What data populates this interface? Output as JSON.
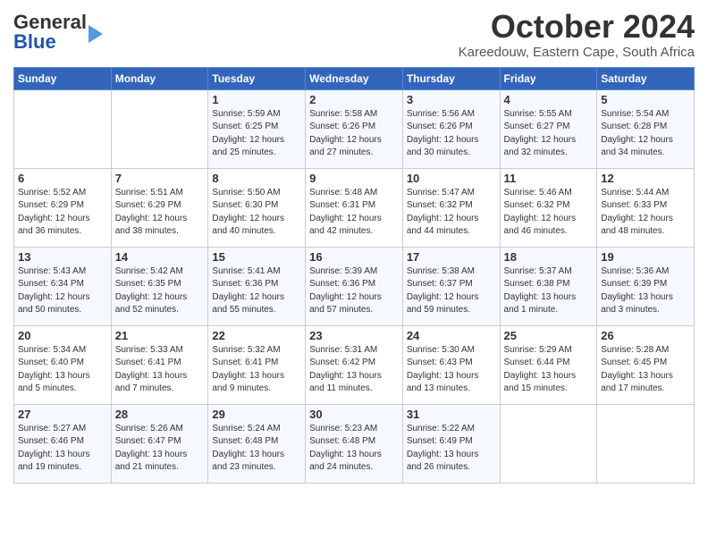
{
  "header": {
    "logo_general": "General",
    "logo_blue": "Blue",
    "month_year": "October 2024",
    "location": "Kareedouw, Eastern Cape, South Africa"
  },
  "days_of_week": [
    "Sunday",
    "Monday",
    "Tuesday",
    "Wednesday",
    "Thursday",
    "Friday",
    "Saturday"
  ],
  "weeks": [
    [
      {
        "day": "",
        "info": ""
      },
      {
        "day": "",
        "info": ""
      },
      {
        "day": "1",
        "info": "Sunrise: 5:59 AM\nSunset: 6:25 PM\nDaylight: 12 hours\nand 25 minutes."
      },
      {
        "day": "2",
        "info": "Sunrise: 5:58 AM\nSunset: 6:26 PM\nDaylight: 12 hours\nand 27 minutes."
      },
      {
        "day": "3",
        "info": "Sunrise: 5:56 AM\nSunset: 6:26 PM\nDaylight: 12 hours\nand 30 minutes."
      },
      {
        "day": "4",
        "info": "Sunrise: 5:55 AM\nSunset: 6:27 PM\nDaylight: 12 hours\nand 32 minutes."
      },
      {
        "day": "5",
        "info": "Sunrise: 5:54 AM\nSunset: 6:28 PM\nDaylight: 12 hours\nand 34 minutes."
      }
    ],
    [
      {
        "day": "6",
        "info": "Sunrise: 5:52 AM\nSunset: 6:29 PM\nDaylight: 12 hours\nand 36 minutes."
      },
      {
        "day": "7",
        "info": "Sunrise: 5:51 AM\nSunset: 6:29 PM\nDaylight: 12 hours\nand 38 minutes."
      },
      {
        "day": "8",
        "info": "Sunrise: 5:50 AM\nSunset: 6:30 PM\nDaylight: 12 hours\nand 40 minutes."
      },
      {
        "day": "9",
        "info": "Sunrise: 5:48 AM\nSunset: 6:31 PM\nDaylight: 12 hours\nand 42 minutes."
      },
      {
        "day": "10",
        "info": "Sunrise: 5:47 AM\nSunset: 6:32 PM\nDaylight: 12 hours\nand 44 minutes."
      },
      {
        "day": "11",
        "info": "Sunrise: 5:46 AM\nSunset: 6:32 PM\nDaylight: 12 hours\nand 46 minutes."
      },
      {
        "day": "12",
        "info": "Sunrise: 5:44 AM\nSunset: 6:33 PM\nDaylight: 12 hours\nand 48 minutes."
      }
    ],
    [
      {
        "day": "13",
        "info": "Sunrise: 5:43 AM\nSunset: 6:34 PM\nDaylight: 12 hours\nand 50 minutes."
      },
      {
        "day": "14",
        "info": "Sunrise: 5:42 AM\nSunset: 6:35 PM\nDaylight: 12 hours\nand 52 minutes."
      },
      {
        "day": "15",
        "info": "Sunrise: 5:41 AM\nSunset: 6:36 PM\nDaylight: 12 hours\nand 55 minutes."
      },
      {
        "day": "16",
        "info": "Sunrise: 5:39 AM\nSunset: 6:36 PM\nDaylight: 12 hours\nand 57 minutes."
      },
      {
        "day": "17",
        "info": "Sunrise: 5:38 AM\nSunset: 6:37 PM\nDaylight: 12 hours\nand 59 minutes."
      },
      {
        "day": "18",
        "info": "Sunrise: 5:37 AM\nSunset: 6:38 PM\nDaylight: 13 hours\nand 1 minute."
      },
      {
        "day": "19",
        "info": "Sunrise: 5:36 AM\nSunset: 6:39 PM\nDaylight: 13 hours\nand 3 minutes."
      }
    ],
    [
      {
        "day": "20",
        "info": "Sunrise: 5:34 AM\nSunset: 6:40 PM\nDaylight: 13 hours\nand 5 minutes."
      },
      {
        "day": "21",
        "info": "Sunrise: 5:33 AM\nSunset: 6:41 PM\nDaylight: 13 hours\nand 7 minutes."
      },
      {
        "day": "22",
        "info": "Sunrise: 5:32 AM\nSunset: 6:41 PM\nDaylight: 13 hours\nand 9 minutes."
      },
      {
        "day": "23",
        "info": "Sunrise: 5:31 AM\nSunset: 6:42 PM\nDaylight: 13 hours\nand 11 minutes."
      },
      {
        "day": "24",
        "info": "Sunrise: 5:30 AM\nSunset: 6:43 PM\nDaylight: 13 hours\nand 13 minutes."
      },
      {
        "day": "25",
        "info": "Sunrise: 5:29 AM\nSunset: 6:44 PM\nDaylight: 13 hours\nand 15 minutes."
      },
      {
        "day": "26",
        "info": "Sunrise: 5:28 AM\nSunset: 6:45 PM\nDaylight: 13 hours\nand 17 minutes."
      }
    ],
    [
      {
        "day": "27",
        "info": "Sunrise: 5:27 AM\nSunset: 6:46 PM\nDaylight: 13 hours\nand 19 minutes."
      },
      {
        "day": "28",
        "info": "Sunrise: 5:26 AM\nSunset: 6:47 PM\nDaylight: 13 hours\nand 21 minutes."
      },
      {
        "day": "29",
        "info": "Sunrise: 5:24 AM\nSunset: 6:48 PM\nDaylight: 13 hours\nand 23 minutes."
      },
      {
        "day": "30",
        "info": "Sunrise: 5:23 AM\nSunset: 6:48 PM\nDaylight: 13 hours\nand 24 minutes."
      },
      {
        "day": "31",
        "info": "Sunrise: 5:22 AM\nSunset: 6:49 PM\nDaylight: 13 hours\nand 26 minutes."
      },
      {
        "day": "",
        "info": ""
      },
      {
        "day": "",
        "info": ""
      }
    ]
  ]
}
